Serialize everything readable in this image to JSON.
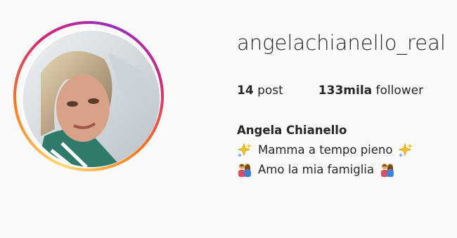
{
  "profile": {
    "username": "angelachianello_real",
    "full_name": "Angela Chianello",
    "stats": {
      "posts_count": "14",
      "posts_label": "post",
      "followers_count": "133mila",
      "followers_label": "follower"
    },
    "bio": [
      {
        "text": "Mamma a tempo pieno",
        "icon": "sparkles-icon"
      },
      {
        "text": "Amo la mia famiglia",
        "icon": "family-icon"
      }
    ],
    "avatar": {
      "icon": "profile-photo",
      "ring_colors": [
        "#feda75",
        "#fa7e1e",
        "#d62976",
        "#962fbf"
      ]
    }
  }
}
